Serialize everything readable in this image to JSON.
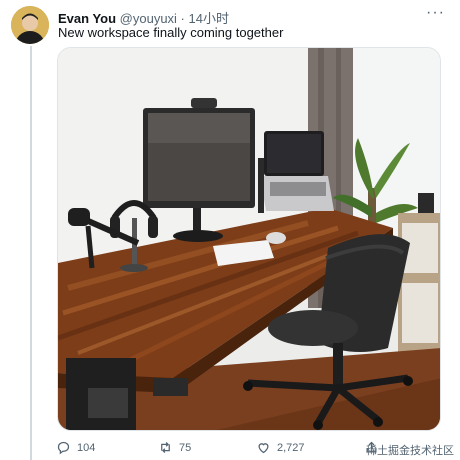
{
  "tweet": {
    "author_name": "Evan You",
    "handle_and_time": "@youyuxi · 14小时",
    "text": "New workspace finally coming together"
  },
  "actions": {
    "replies": "104",
    "retweets": "75",
    "likes": "2,727"
  },
  "icons": [
    "more-icon",
    "reply-icon",
    "retweet-icon",
    "like-icon",
    "share-icon"
  ],
  "watermark": "稀土掘金技术社区"
}
